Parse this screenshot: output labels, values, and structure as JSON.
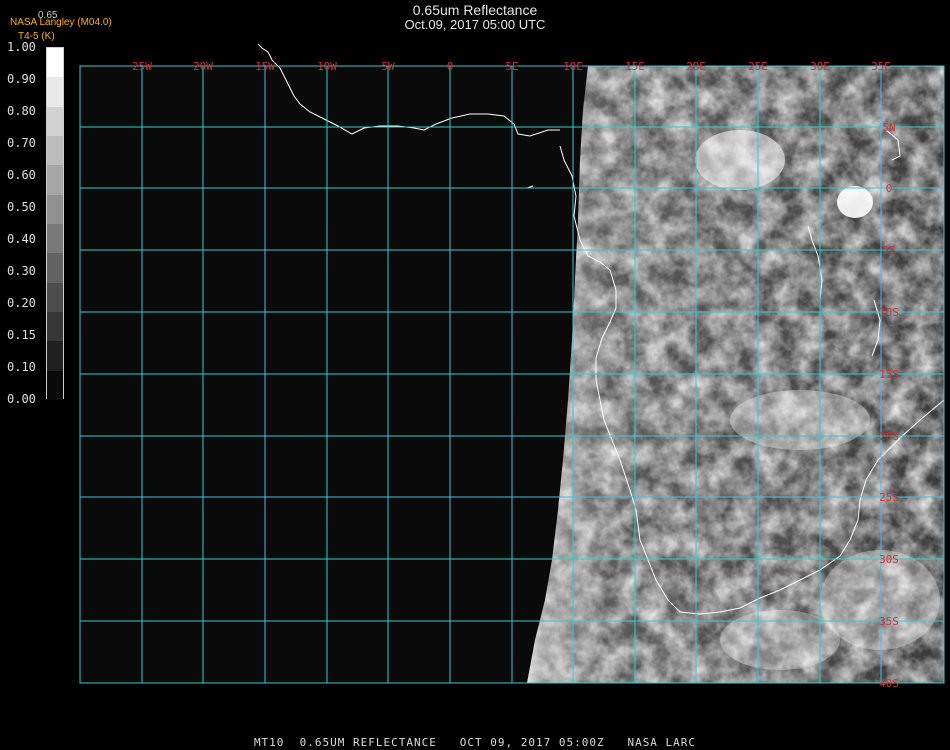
{
  "title": "0.65um Reflectance",
  "subtitle": "Oct.09, 2017 05:00 UTC",
  "org": {
    "line1": "NASA Langley (M04.0)",
    "line2": "T4-5 (K)"
  },
  "colorbar": {
    "max_label": "0.65",
    "ticks": [
      "1.00",
      "0.90",
      "0.80",
      "0.70",
      "0.60",
      "0.50",
      "0.40",
      "0.30",
      "0.20",
      "0.15",
      "0.10",
      "0.00"
    ]
  },
  "grid": {
    "longitudes": [
      "25W",
      "20W",
      "15W",
      "10W",
      "5W",
      "0",
      "5E",
      "10E",
      "15E",
      "20E",
      "25E",
      "30E",
      "35E"
    ],
    "latitudes": [
      "5N",
      "0",
      "5S",
      "10S",
      "15S",
      "20S",
      "25S",
      "30S",
      "35S",
      "40S"
    ],
    "color": "#36c8d8"
  },
  "footer": "MT10  0.65UM REFLECTANCE   OCT 09, 2017 05:00Z   NASA LARC",
  "colors": {
    "label": "#d43030",
    "grid": "#36c8d8",
    "coast": "#ffffff"
  }
}
